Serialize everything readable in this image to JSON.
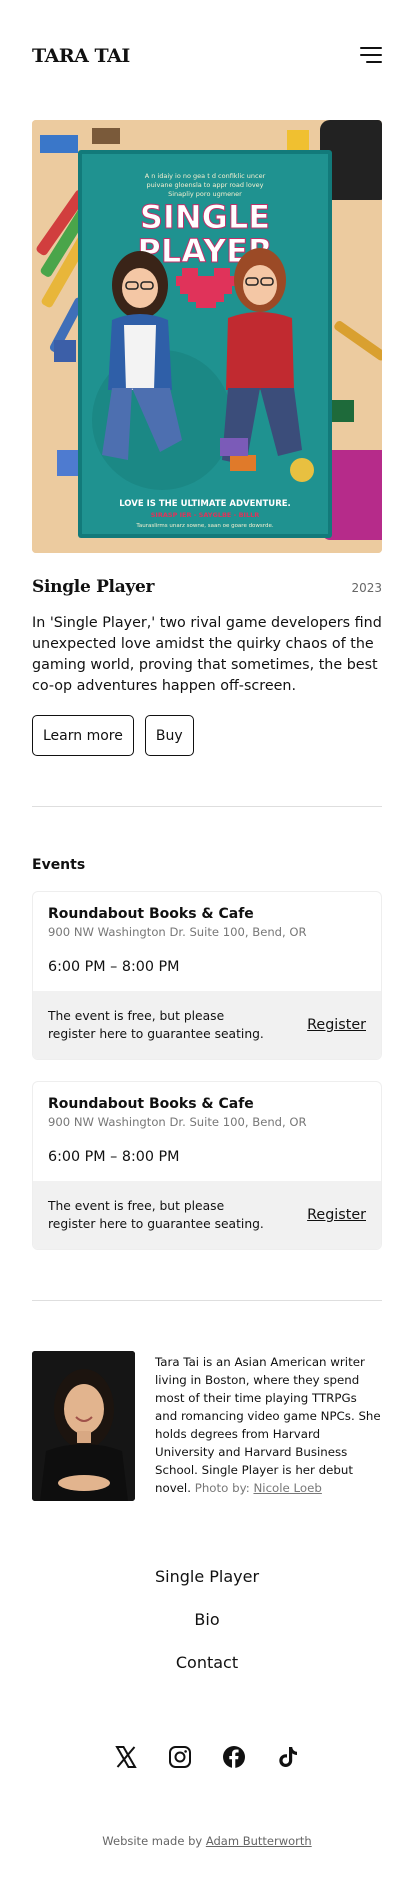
{
  "header": {
    "brand": "TARA TAI",
    "menu_icon": "hamburger-menu-icon"
  },
  "book": {
    "cover_title": "SINGLE PLAYER",
    "cover_tagline": "LOVE IS THE ULTIMATE ADVENTURE.",
    "title": "Single Player",
    "year": "2023",
    "description": "In 'Single Player,' two rival game developers find unexpected love amidst the quirky chaos of the gaming world, proving that sometimes, the best co-op adventures happen off-screen.",
    "learn_more_label": "Learn more",
    "buy_label": "Buy"
  },
  "events": {
    "title": "Events",
    "items": [
      {
        "venue": "Roundabout Books & Cafe",
        "address": "900 NW Washington Dr. Suite 100, Bend, OR",
        "time": "6:00 PM – 8:00 PM",
        "note": "The event is free, but please register here to guarantee seating.",
        "register_label": "Register"
      },
      {
        "venue": "Roundabout Books & Cafe",
        "address": "900 NW Washington Dr. Suite 100, Bend, OR",
        "time": "6:00 PM – 8:00 PM",
        "note": "The event is free, but please register here to guarantee seating.",
        "register_label": "Register"
      }
    ]
  },
  "bio": {
    "text": "Tara Tai is an Asian American writer living in Boston, where they spend most of their time playing TTRPGs and romancing video game NPCs. She holds degrees from Harvard University and Harvard Business School. Single Player is her debut novel.",
    "photo_credit_prefix": "Photo by:",
    "photo_credit_name": "Nicole Loeb"
  },
  "footer_nav": [
    "Single Player",
    "Bio",
    "Contact"
  ],
  "socials": [
    "x-icon",
    "instagram-icon",
    "facebook-icon",
    "tiktok-icon"
  ],
  "made_by": {
    "prefix": "Website made by",
    "name": "Adam Butterworth"
  },
  "colors": {
    "text": "#111111",
    "muted": "#777777",
    "divider": "#dedede",
    "event_footer_bg": "#f1f1f1",
    "cover_teal": "#1f8a86",
    "cover_pink": "#e0335a"
  }
}
